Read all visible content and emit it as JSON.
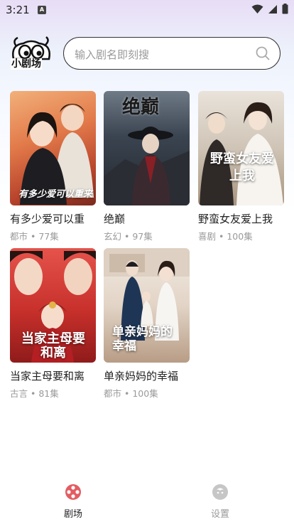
{
  "status": {
    "time": "3:21",
    "notification_letter": "A"
  },
  "app": {
    "logo_text": "小剧场"
  },
  "search": {
    "placeholder": "输入剧名即刻搜"
  },
  "dramas": [
    {
      "title": "有多少爱可以重",
      "genre": "都市",
      "episodes": "77集",
      "poster_text": "有多少爱可以重来"
    },
    {
      "title": "绝巅",
      "genre": "玄幻",
      "episodes": "97集",
      "poster_text": "绝巅"
    },
    {
      "title": "野蛮女友爱上我",
      "genre": "喜剧",
      "episodes": "100集",
      "poster_text": "野蛮女友爱上我"
    },
    {
      "title": "当家主母要和离",
      "genre": "古言",
      "episodes": "81集",
      "poster_text": "当家主母要和离"
    },
    {
      "title": "单亲妈妈的幸福",
      "genre": "都市",
      "episodes": "100集",
      "poster_text": "单亲妈妈的幸福"
    }
  ],
  "meta_separator": "•",
  "nav": [
    {
      "label": "剧场",
      "active": true,
      "icon": "film-reel-icon"
    },
    {
      "label": "设置",
      "active": false,
      "icon": "settings-icon"
    }
  ],
  "colors": {
    "accent": "#e25d62",
    "inactive": "#9a9a9a"
  }
}
